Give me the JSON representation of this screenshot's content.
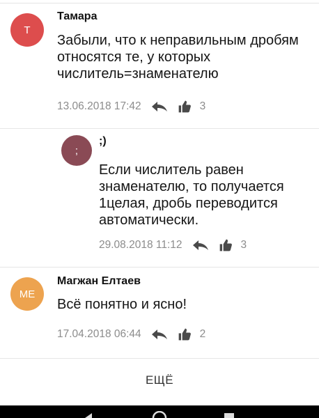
{
  "comments": [
    {
      "initials": "Т",
      "avatar_color": "#dd4d4d",
      "author": "Тамара",
      "text_lines": [
        "Забыли, что к неправильным дробям",
        "относятся те, у которых",
        "числитель=знаменателю"
      ],
      "timestamp": "13.06.2018 17:42",
      "likes": "3"
    },
    {
      "initials": ";",
      "avatar_color": "#8a4a55",
      "author": ";)",
      "text_lines": [
        "Если числитель равен",
        "знаменателю, то получается",
        "1целая, дробь переводится",
        "автоматически."
      ],
      "timestamp": "29.08.2018 11:12",
      "likes": "3"
    },
    {
      "initials": "МЕ",
      "avatar_color": "#eda34f",
      "author": "Магжан Елтаев",
      "text_lines": [
        "Всё понятно и ясно!"
      ],
      "timestamp": "17.04.2018 06:44",
      "likes": "2"
    }
  ],
  "more_label": "ЕЩЁ",
  "icons": {
    "reply": "reply-arrow-icon",
    "like": "thumbs-up-icon"
  }
}
